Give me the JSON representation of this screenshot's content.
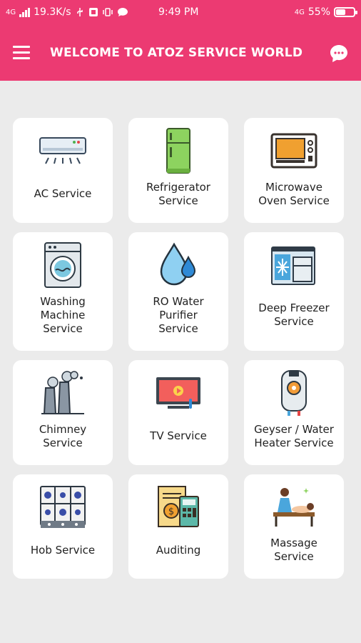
{
  "status_bar": {
    "network": "4G",
    "speed": "19.3K/s",
    "time": "9:49 PM",
    "network_right": "4G",
    "battery": "55%",
    "battery_level": 0.55
  },
  "app_bar": {
    "title": "WELCOME TO ATOZ SERVICE WORLD",
    "menu_icon": "hamburger-menu-icon",
    "chat_icon": "chat-support-icon"
  },
  "services": [
    {
      "label": "AC Service",
      "icon": "air-conditioner-icon"
    },
    {
      "label": "Refrigerator\nService",
      "icon": "refrigerator-icon"
    },
    {
      "label": "Microwave\nOven Service",
      "icon": "microwave-icon"
    },
    {
      "label": "Washing\nMachine\nService",
      "icon": "washing-machine-icon"
    },
    {
      "label": "RO Water\nPurifier\nService",
      "icon": "water-drop-icon"
    },
    {
      "label": "Deep Freezer\nService",
      "icon": "freezer-icon"
    },
    {
      "label": "Chimney\nService",
      "icon": "chimney-icon"
    },
    {
      "label": "TV Service",
      "icon": "tv-icon"
    },
    {
      "label": "Geyser / Water\nHeater Service",
      "icon": "geyser-icon"
    },
    {
      "label": "Hob Service",
      "icon": "hob-icon"
    },
    {
      "label": "Auditing",
      "icon": "auditing-icon"
    },
    {
      "label": "Massage\nService",
      "icon": "massage-icon"
    }
  ],
  "colors": {
    "primary": "#ec3a72",
    "background": "#ebebeb",
    "card": "#ffffff"
  }
}
